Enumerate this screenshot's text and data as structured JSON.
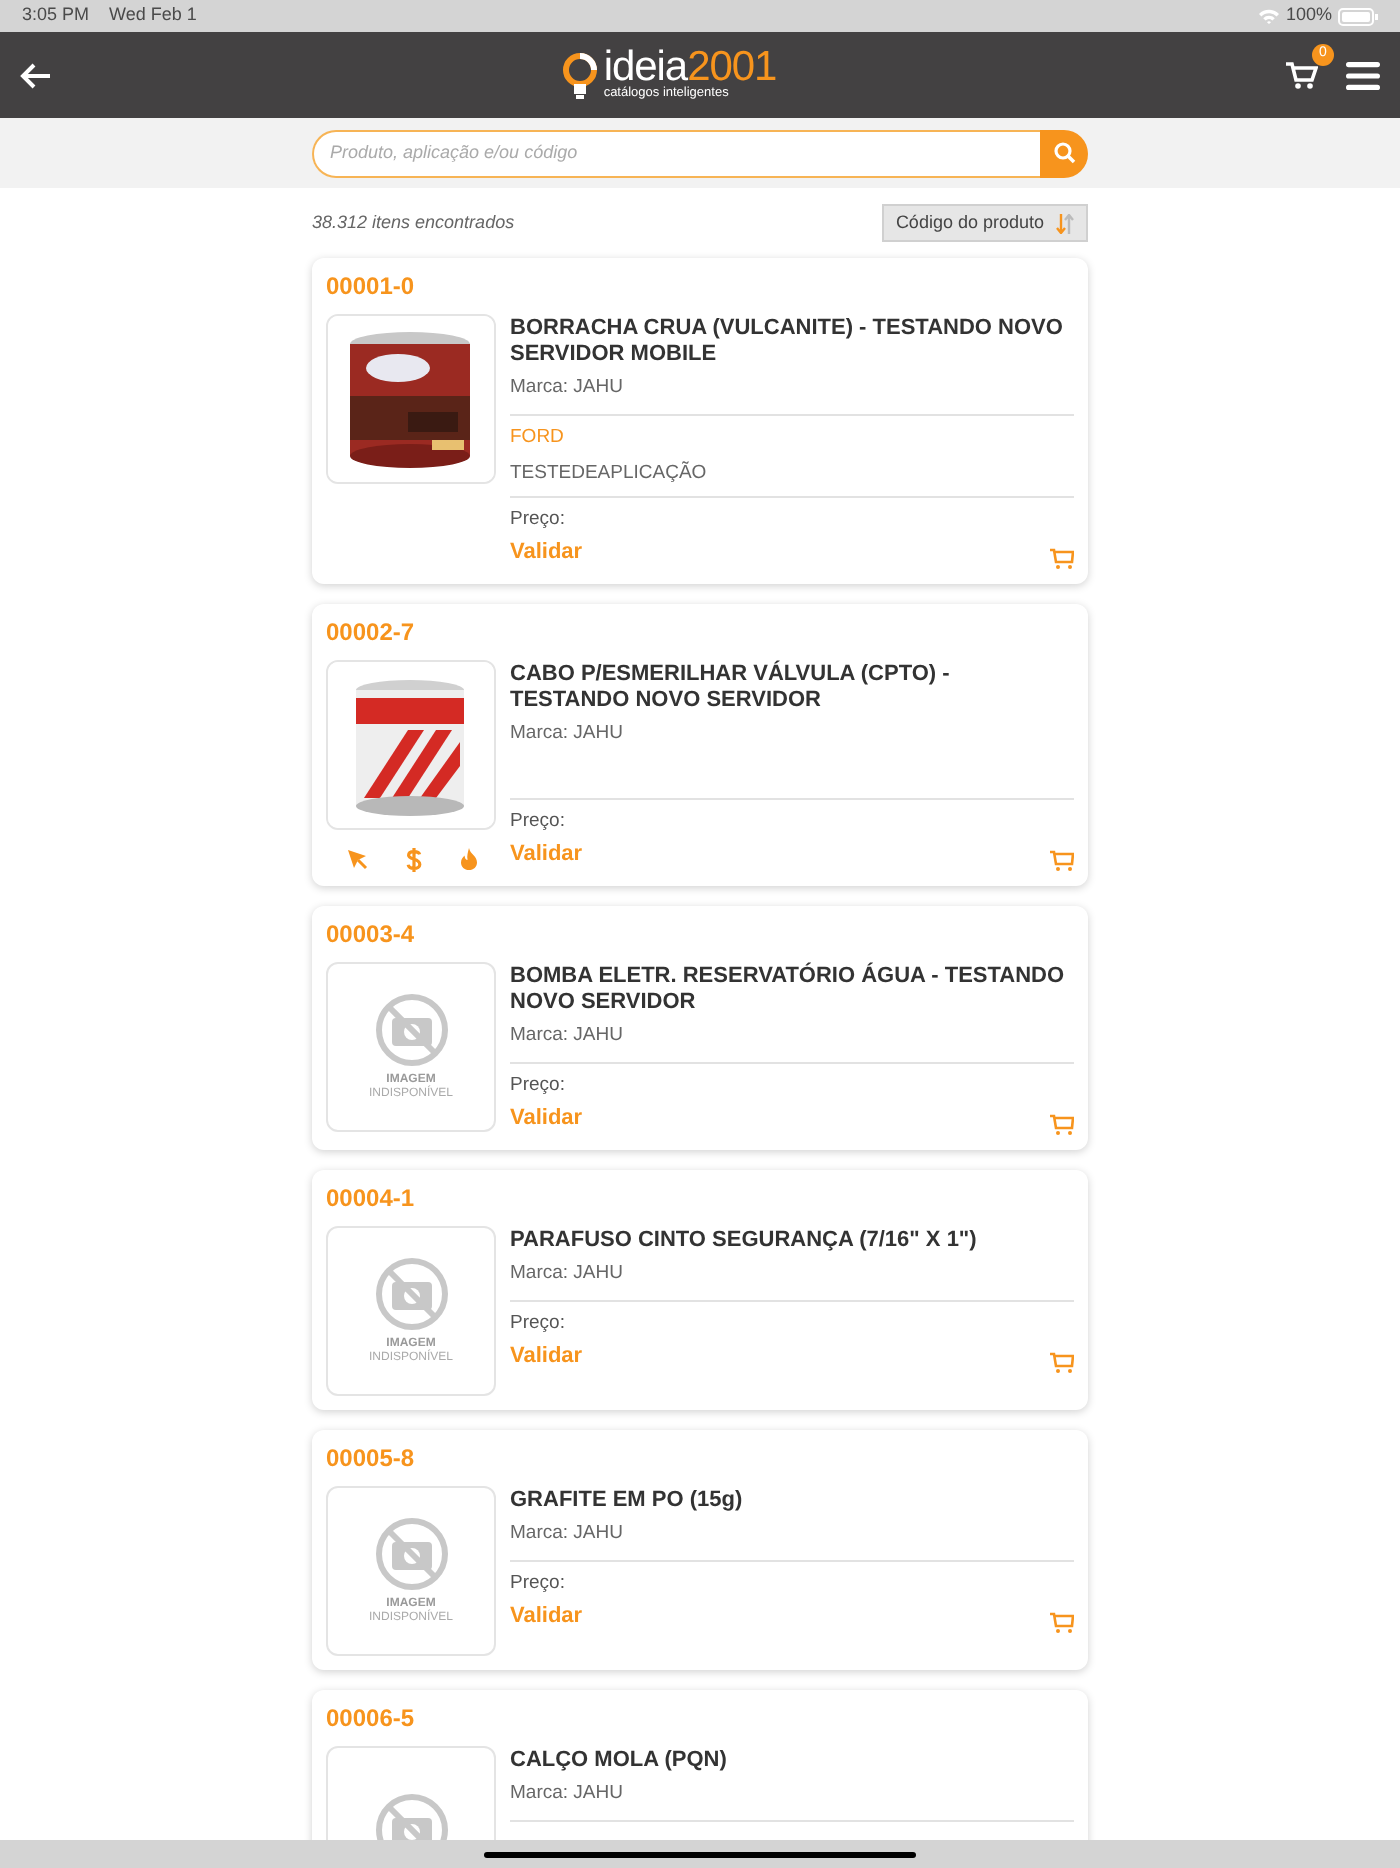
{
  "status_bar": {
    "time": "3:05 PM",
    "date": "Wed Feb 1",
    "battery": "100%"
  },
  "header": {
    "logo_main": "ideia",
    "logo_accent": "2001",
    "logo_tagline": "catálogos inteligentes",
    "cart_count": "0"
  },
  "search": {
    "placeholder": "Produto, aplicação e/ou código"
  },
  "results": {
    "count": "38.312 itens encontrados",
    "sort": "Código do produto"
  },
  "products": [
    {
      "code": "00001-0",
      "title": "BORRACHA CRUA (VULCANITE) - TESTANDO NOVO SERVIDOR MOBILE",
      "brand": "Marca: JAHU",
      "application": {
        "maker": "FORD",
        "text": "TESTEDEAPLICAÇÃO"
      },
      "price_label": "Preço:",
      "price_value": "Validar"
    },
    {
      "code": "00002-7",
      "badges": [
        {
          "kind": "launch"
        },
        {
          "kind": "offer"
        },
        {
          "kind": "hot"
        }
      ],
      "title": "CABO P/ESMERILHAR VÁLVULA (CPTO) - TESTANDO NOVO SERVIDOR",
      "brand": "Marca: JAHU",
      "price_label": "Preço:",
      "price_value": "Validar"
    },
    {
      "code": "00003-4",
      "image": {
        "kind": "unavailable",
        "caption_top": "IMAGEM",
        "caption_bottom": "INDISPONÍVEL"
      },
      "title": "BOMBA ELETR. RESERVATÓRIO ÁGUA - TESTANDO NOVO SERVIDOR",
      "brand": "Marca: JAHU",
      "price_label": "Preço:",
      "price_value": "Validar"
    },
    {
      "code": "00004-1",
      "image": {
        "kind": "unavailable",
        "caption_top": "IMAGEM",
        "caption_bottom": "INDISPONÍVEL"
      },
      "title": "PARAFUSO CINTO SEGURANÇA (7/16\" X 1\")",
      "brand": "Marca: JAHU",
      "price_label": "Preço:",
      "price_value": "Validar"
    },
    {
      "code": "00005-8",
      "image": {
        "kind": "unavailable",
        "caption_top": "IMAGEM",
        "caption_bottom": "INDISPONÍVEL"
      },
      "title": "GRAFITE EM PO (15g)",
      "brand": "Marca: JAHU",
      "price_label": "Preço:",
      "price_value": "Validar"
    },
    {
      "code": "00006-5",
      "image": {
        "kind": "unavailable"
      },
      "title": "CALÇO MOLA (PQN)",
      "brand": "Marca: JAHU"
    }
  ]
}
